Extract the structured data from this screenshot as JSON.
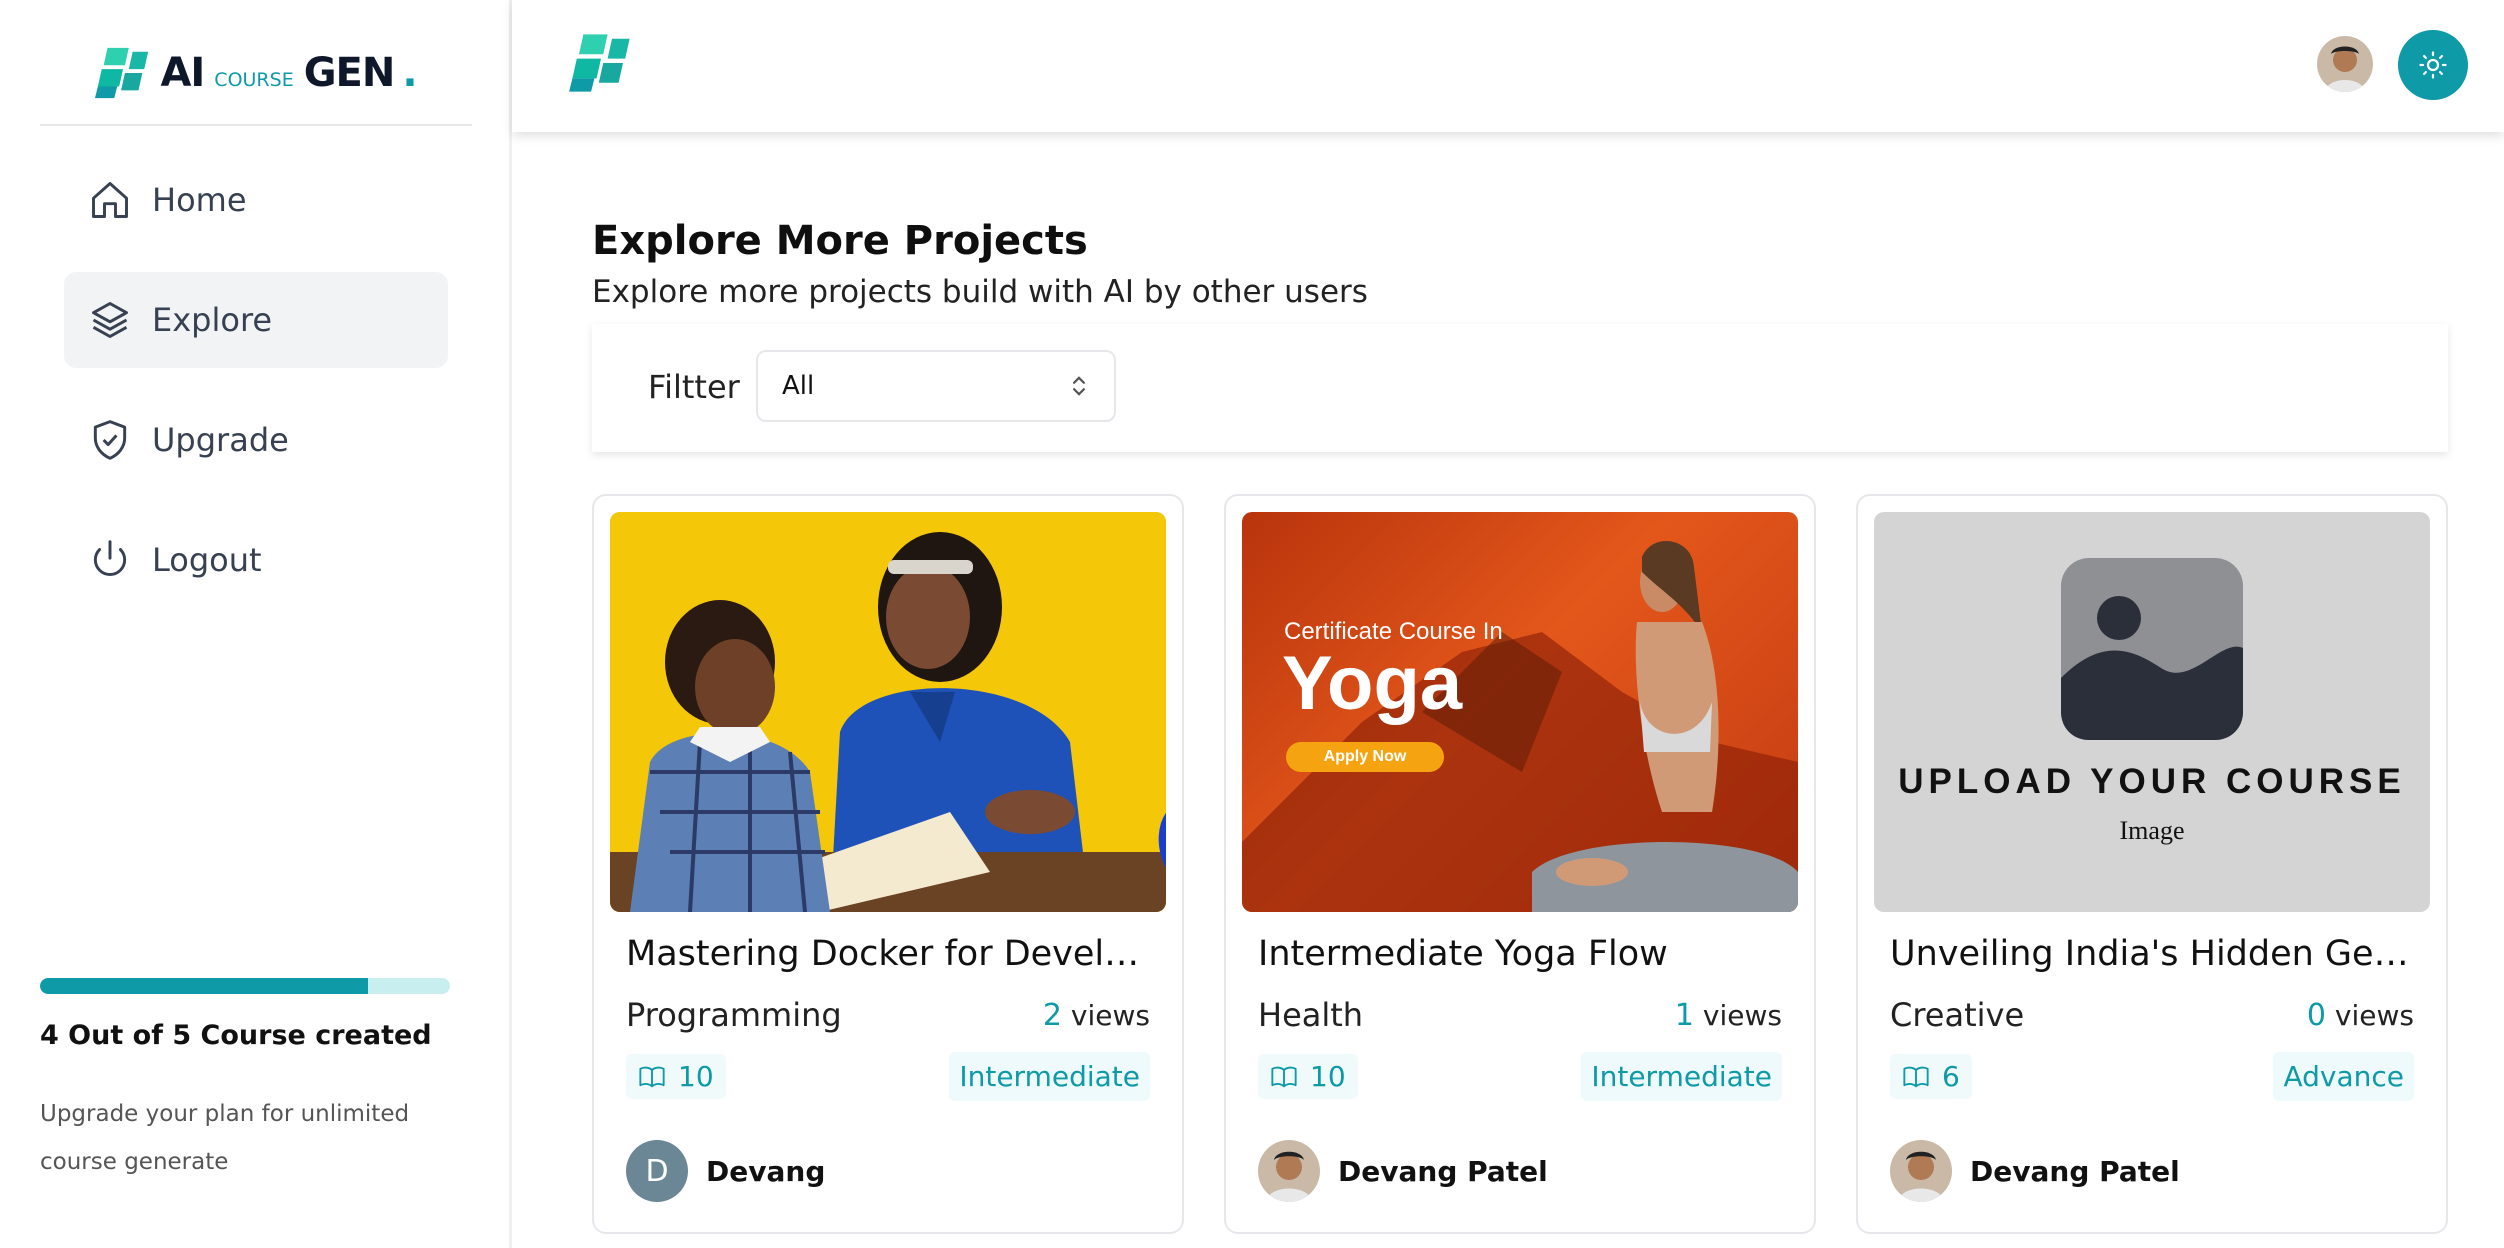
{
  "brand": {
    "ai": "AI",
    "course": "COURSE",
    "gen": "GEN",
    "dot": ".",
    "accent": "#0e9aa7"
  },
  "sidebar": {
    "items": [
      {
        "label": "Home",
        "icon": "home-icon"
      },
      {
        "label": "Explore",
        "icon": "layers-icon",
        "active": true
      },
      {
        "label": "Upgrade",
        "icon": "shield-check-icon"
      },
      {
        "label": "Logout",
        "icon": "power-icon"
      }
    ],
    "usage": {
      "progress": 0.8,
      "title": "4 Out of 5 Course created",
      "description": "Upgrade your plan for unlimited course generate"
    }
  },
  "header": {
    "theme_toggle_icon": "sun-icon"
  },
  "main": {
    "title": "Explore More Projects",
    "subtitle": "Explore more projects build with AI by other users",
    "filter": {
      "label": "Filtter",
      "value": "All"
    }
  },
  "cards": [
    {
      "title": "Mastering Docker for Develop...",
      "category": "Programming",
      "views": "2",
      "views_label": "views",
      "chapters": "10",
      "level": "Intermediate",
      "author": "Devang",
      "author_initial": "D"
    },
    {
      "title": "Intermediate Yoga Flow",
      "category": "Health",
      "views": "1",
      "views_label": "views",
      "chapters": "10",
      "level": "Intermediate",
      "author": "Devang Patel",
      "banner": {
        "small": "Certificate Course In",
        "big": "Yoga",
        "button": "Apply Now"
      }
    },
    {
      "title": "Unveiling India's Hidden Gems:...",
      "category": "Creative",
      "views": "0",
      "views_label": "views",
      "chapters": "6",
      "level": "Advance",
      "author": "Devang Patel",
      "placeholder": {
        "title": "UPLOAD YOUR COURSE",
        "sub": "Image"
      }
    }
  ]
}
